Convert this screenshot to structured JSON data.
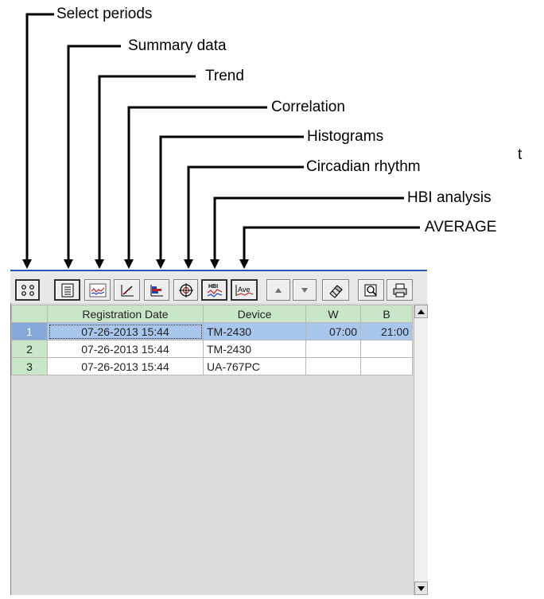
{
  "callouts": {
    "select_periods": "Select periods",
    "summary_data": "Summary data",
    "trend": "Trend",
    "correlation": "Correlation",
    "histograms": "Histograms",
    "circadian_rhythm": "Circadian rhythm",
    "hbi_analysis": "HBI analysis",
    "average": "AVERAGE",
    "stray": "t"
  },
  "toolbar": {
    "icons": [
      "select-periods-icon",
      "summary-data-icon",
      "trend-icon",
      "correlation-icon",
      "histogram-icon",
      "circadian-rhythm-icon",
      "hbi-analysis-icon",
      "average-icon",
      "move-up-icon",
      "move-down-icon",
      "eraser-icon",
      "search-icon",
      "print-icon"
    ],
    "hbi_text": "HBI",
    "ave_text": "Ave"
  },
  "table": {
    "columns": [
      "",
      "Registration Date",
      "Device",
      "W",
      "B"
    ],
    "rows": [
      {
        "num": "1",
        "date": "07-26-2013 15:44",
        "device": "TM-2430",
        "w": "07:00",
        "b": "21:00"
      },
      {
        "num": "2",
        "date": "07-26-2013 15:44",
        "device": "TM-2430",
        "w": "",
        "b": ""
      },
      {
        "num": "3",
        "date": "07-26-2013 15:44",
        "device": "UA-767PC",
        "w": "",
        "b": ""
      }
    ],
    "selected_row": 1
  },
  "colors": {
    "header_green": "#c8e6c8",
    "selection_blue": "#a9c6ec",
    "title_bar_blue": "#2a55b8"
  }
}
